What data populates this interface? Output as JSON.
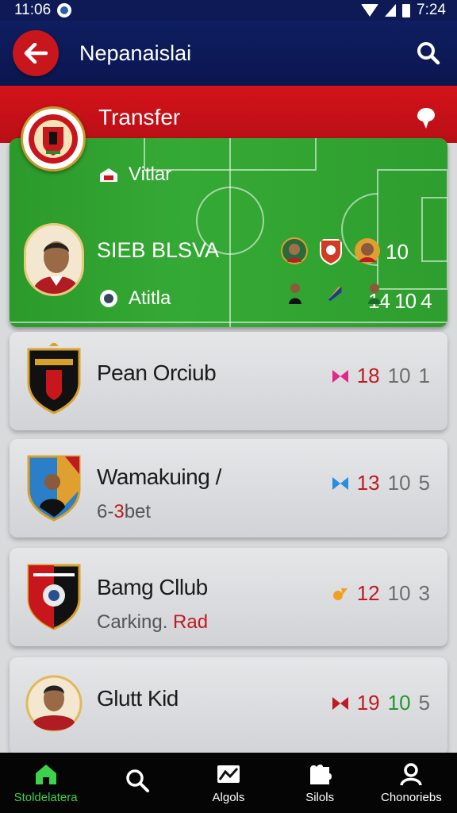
{
  "status_bar": {
    "time": "11:06",
    "right_time": "7:24"
  },
  "app_bar": {
    "title": "Nepanaislai"
  },
  "transfer": {
    "title": "Transfer"
  },
  "featured": {
    "venue": "Vitlar",
    "stats": "14 10 4",
    "player_name": "SIEB BLSVA",
    "number": "10",
    "team": "Atitla"
  },
  "cards": [
    {
      "name": "Pean Orciub",
      "sub": "",
      "stat1": "18",
      "stat2": "10",
      "stat3": "1",
      "icon_color": "#e0278a"
    },
    {
      "name": "Wamakuing /",
      "sub_a": "6-",
      "sub_b": "3",
      "sub_c": "bet",
      "stat1": "13",
      "stat2": "10",
      "stat3": "5",
      "icon_color": "#2a8be0"
    },
    {
      "name": "Bamg Cllub",
      "sub_a": "Carking. ",
      "sub_b": "Rad",
      "stat1": "12",
      "stat2": "10",
      "stat3": "3",
      "icon_color": "#f0a020"
    },
    {
      "name": "Glutt Kid",
      "sub": "",
      "stat1": "19",
      "stat2": "10",
      "stat3": "5",
      "icon_color": "#c01a22"
    }
  ],
  "nav": [
    {
      "label": "Stoldelatera",
      "icon": "home-icon",
      "active": true
    },
    {
      "label": "",
      "icon": "search-icon",
      "active": false
    },
    {
      "label": "Algols",
      "icon": "stats-icon",
      "active": false
    },
    {
      "label": "Silols",
      "icon": "puzzle-icon",
      "active": false
    },
    {
      "label": "Chonoriebs",
      "icon": "profile-icon",
      "active": false
    }
  ],
  "colors": {
    "brand_navy": "#0d1a55",
    "brand_red": "#c8161d",
    "pitch_green": "#2e9e2e",
    "active_green": "#3dd14c"
  }
}
